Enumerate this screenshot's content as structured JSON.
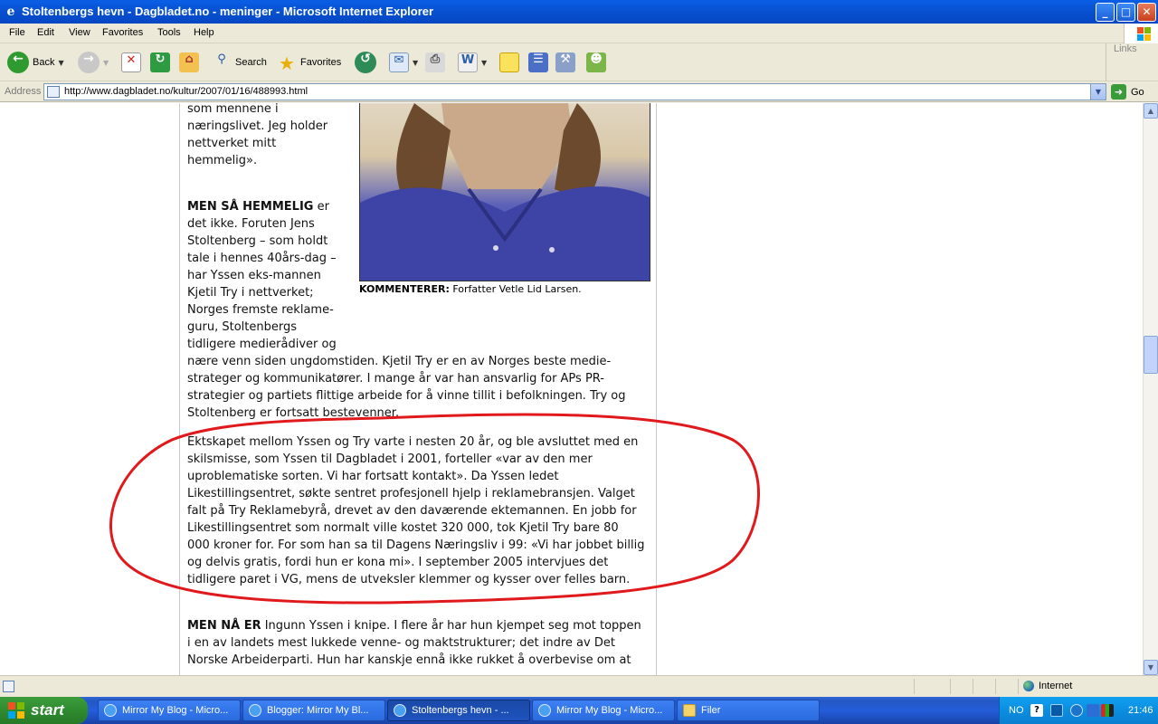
{
  "window": {
    "title": "Stoltenbergs hevn - Dagbladet.no - meninger - Microsoft Internet Explorer",
    "buttons": {
      "minimize": "_",
      "maximize": "□",
      "close": "✕"
    }
  },
  "menu": [
    "File",
    "Edit",
    "View",
    "Favorites",
    "Tools",
    "Help"
  ],
  "toolbar": {
    "back": "Back",
    "search": "Search",
    "favorites": "Favorites",
    "links": "Links"
  },
  "address": {
    "label": "Address",
    "url": "http://www.dagbladet.no/kultur/2007/01/16/488993.html",
    "go": "Go"
  },
  "article": {
    "p1_lines": [
      "som mennene i",
      "næringslivet. Jeg holder",
      "nettverket mitt",
      "hemmelig»."
    ],
    "p2_lead": "MEN SÅ HEMMELIG",
    "p2_first": " er",
    "p2_lines": [
      "det ikke. Foruten Jens",
      "Stoltenberg – som holdt",
      "tale i hennes 40års-dag –",
      "har Yssen eks-mannen",
      "Kjetil Try i nettverket;",
      "Norges fremste reklame-",
      "guru, Stoltenbergs",
      "tidligere medierådiver og"
    ],
    "p2_wide_lines": [
      "nære venn siden ungdomstiden. Kjetil Try er en av Norges beste medie-",
      "strateger og kommunikatører. I mange år var han ansvarlig for APs PR-",
      "strategier og partiets flittige arbeide for å vinne tillit i befolkningen. Try og",
      "Stoltenberg er fortsatt bestevenner."
    ],
    "p3_lines": [
      "Ektskapet mellom Yssen og Try varte i nesten 20 år, og ble avsluttet med en",
      "skilsmisse, som Yssen til Dagbladet i 2001, forteller «var av den mer",
      "uproblematiske sorten. Vi har fortsatt kontakt». Da Yssen ledet",
      "Likestillingsentret, søkte sentret profesjonell hjelp i reklamebransjen. Valget",
      "falt på Try Reklamebyrå, drevet av den daværende ektemannen. En jobb for",
      "Likestillingsentret som normalt ville kostet 320 000, tok Kjetil Try bare 80",
      "000 kroner for. For som han sa til Dagens Næringsliv i 99: «Vi har jobbet billig",
      "og delvis gratis, fordi hun er kona mi». I september 2005 intervjues det",
      "tidligere paret i VG, mens de utveksler klemmer og kysser over felles barn."
    ],
    "p4_lead": "MEN NÅ ER",
    "p4_first": " Ingunn Yssen i knipe. I flere år har hun kjempet seg mot toppen",
    "p4_lines": [
      "i en av landets mest lukkede venne- og maktstrukturer; det indre av Det",
      "Norske Arbeiderparti. Hun har kanskje ennå ikke rukket å overbevise om at"
    ],
    "caption_lead": "KOMMENTERER:",
    "caption_text": " Forfatter Vetle Lid Larsen."
  },
  "annotation": {
    "color": "#e0191c"
  },
  "status": {
    "zone": "Internet"
  },
  "taskbar": {
    "start": "start",
    "tasks": [
      "Mirror My Blog - Micro...",
      "Blogger: Mirror My Bl...",
      "Stoltenbergs hevn - ...",
      "Mirror My Blog - Micro...",
      "Filer"
    ],
    "lang": "NO",
    "clock": "21:46"
  },
  "colors": {
    "titlebar": "#0853d3",
    "chrome": "#ece9d8",
    "taskbar": "#245edb",
    "start": "#2f8b2f",
    "tray": "#0b8ee0"
  }
}
